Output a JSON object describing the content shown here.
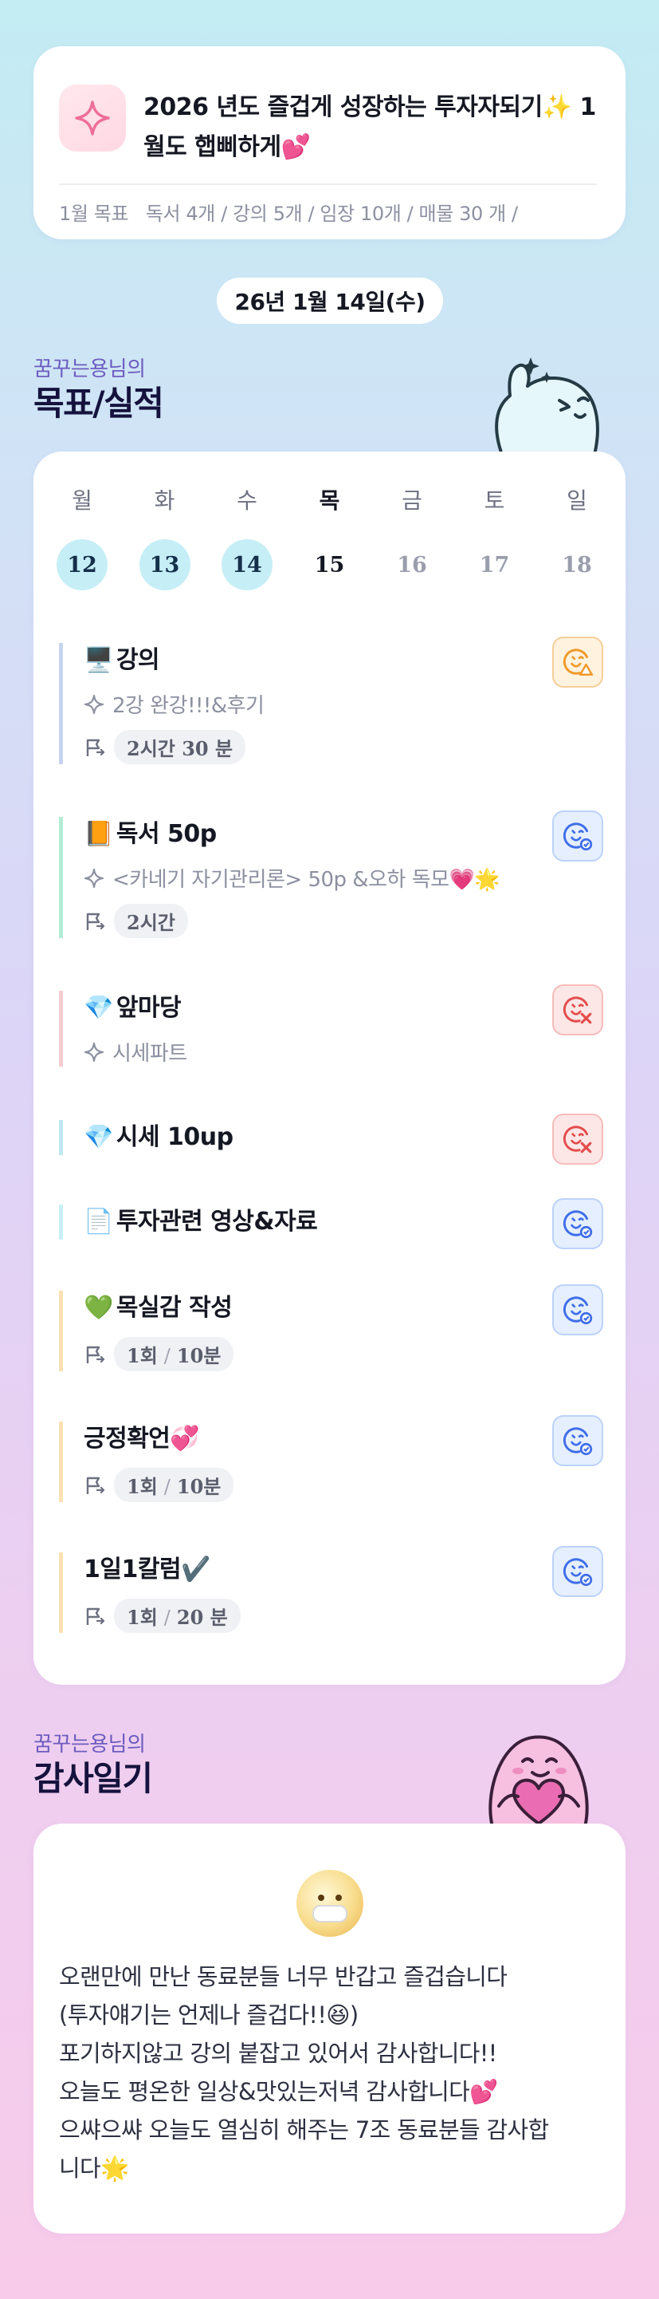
{
  "goal": {
    "title_line1": "2026 년도 즐겁게 성장하는 투자자되기✨ 1",
    "title_line2": "월도 햅삐하게💕",
    "sub_label": "1월 목표",
    "sub_text": "독서 4개 / 강의 5개 / 임장 10개 / 매물 30 개 /"
  },
  "date": "26년 1월 14일(수)",
  "goals_section": {
    "sub": "꿈꾸는용님의",
    "title": "목표/실적"
  },
  "week": [
    {
      "name": "월",
      "num": "12",
      "state": "done"
    },
    {
      "name": "화",
      "num": "13",
      "state": "done"
    },
    {
      "name": "수",
      "num": "14",
      "state": "done"
    },
    {
      "name": "목",
      "num": "15",
      "state": "today"
    },
    {
      "name": "금",
      "num": "16",
      "state": "future"
    },
    {
      "name": "토",
      "num": "17",
      "state": "future"
    },
    {
      "name": "일",
      "num": "18",
      "state": "future"
    }
  ],
  "tasks": [
    {
      "emoji": "🖥️",
      "title": "강의",
      "note": "2강 완강!!!&후기",
      "meta": "2시간 30 분",
      "status": "partial",
      "color": "#c6d3ee"
    },
    {
      "emoji": "📙",
      "title": "독서 50p",
      "note": "<카네기 자기관리론> 50p &오하 독모💗🌟",
      "meta": "2시간",
      "status": "done",
      "color": "#b4ecd5"
    },
    {
      "emoji": "💎",
      "title": "앞마당",
      "note": "시세파트",
      "meta": "",
      "status": "fail",
      "color": "#f7ccd1"
    },
    {
      "emoji": "💎",
      "title": "시세 10up",
      "note": "",
      "meta": "",
      "status": "fail",
      "color": "#bfe9f2"
    },
    {
      "emoji": "📄",
      "title": "투자관련 영상&자료",
      "note": "",
      "meta": "",
      "status": "done",
      "color": "#c8eff6"
    },
    {
      "emoji": "💚",
      "title": "목실감 작성",
      "note": "",
      "meta_a": "1회",
      "meta_b": "10분",
      "status": "done",
      "color": "#fbe1b3"
    },
    {
      "emoji": "",
      "title": "긍정확언💞",
      "note": "",
      "meta_a": "1회",
      "meta_b": "10분",
      "status": "done",
      "color": "#fbe1b3"
    },
    {
      "emoji": "",
      "title": "1일1칼럼✔️",
      "note": "",
      "meta_a": "1회",
      "meta_b": "20 분",
      "status": "done",
      "color": "#fbe1b3"
    }
  ],
  "thanks_section": {
    "sub": "꿈꾸는용님의",
    "title": "감사일기"
  },
  "thanks": {
    "lines": [
      "오랜만에 만난 동료분들 너무 반갑고 즐겁습니다",
      "(투자얘기는 언제나 즐겁다!!😆)",
      "포기하지않고 강의 붙잡고 있어서 감사합니다!!",
      "오늘도 평온한 일상&맛있는저녁 감사합니다💕",
      "으쌰으쌰 오늘도 열심히 해주는 7조 동료분들 감사합",
      "니다🌟"
    ]
  },
  "colors": {
    "accent_purple": "#6d5cc0",
    "done_day": "#c6eef6",
    "status_partial": "#f09a2a",
    "status_done": "#3f6ee8",
    "status_fail": "#e44c4c"
  }
}
